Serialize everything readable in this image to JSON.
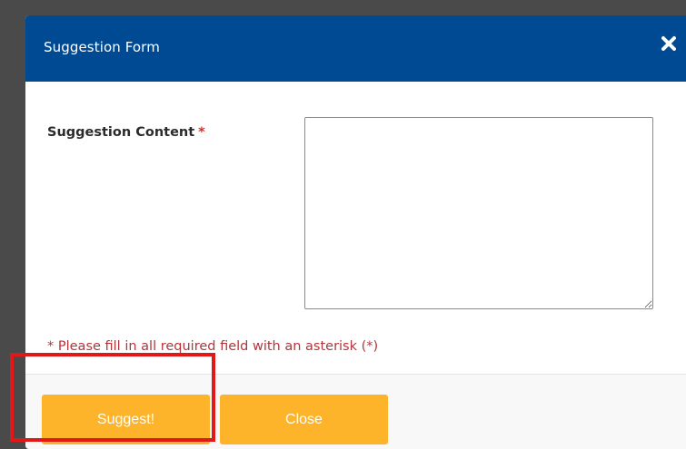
{
  "modal": {
    "title": "Suggestion Form",
    "close_icon": "close-icon",
    "colors": {
      "header": "#004a94",
      "button": "#fdb32a",
      "required": "#e0281e",
      "hint": "#b3353a",
      "highlight": "#e01818"
    }
  },
  "form": {
    "label": "Suggestion Content",
    "required_marker": "*",
    "textarea_value": "",
    "hint": "* Please fill in all required field with an asterisk (*)"
  },
  "footer": {
    "suggest_label": "Suggest!",
    "close_label": "Close"
  }
}
